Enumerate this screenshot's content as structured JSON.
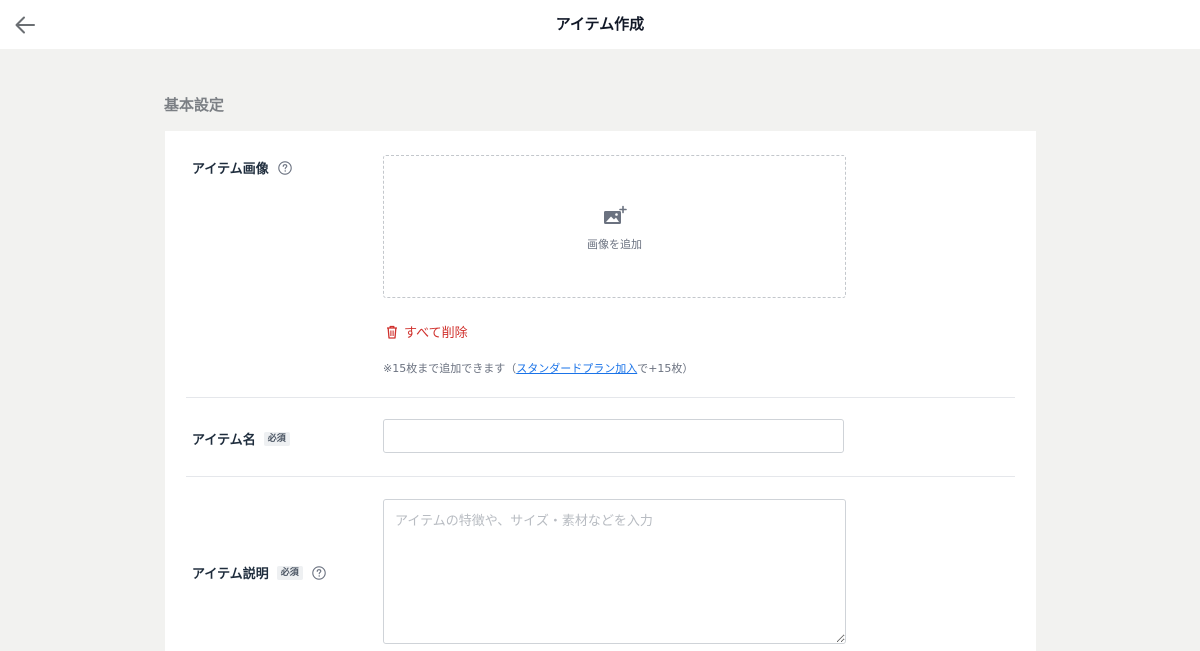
{
  "header": {
    "title": "アイテム作成"
  },
  "section": {
    "title": "基本設定"
  },
  "image_field": {
    "label": "アイテム画像",
    "dropzone_text": "画像を追加",
    "delete_all": "すべて削除",
    "note_prefix": "※15枚まで追加できます（",
    "note_link": "スタンダードプラン加入",
    "note_suffix": "で+15枚）"
  },
  "name_field": {
    "label": "アイテム名",
    "required_badge": "必須",
    "value": ""
  },
  "description_field": {
    "label": "アイテム説明",
    "required_badge": "必須",
    "placeholder": "アイテムの特徴や、サイズ・素材などを入力"
  },
  "colors": {
    "danger": "#d0312d",
    "link": "#1a73e8",
    "background": "#f2f2f0"
  }
}
